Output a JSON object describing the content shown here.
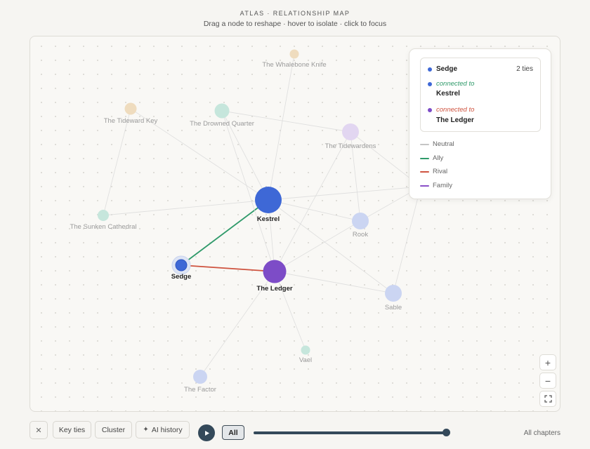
{
  "header": {
    "title": "ATLAS · RELATIONSHIP MAP",
    "subtitle": "Drag a node to reshape · hover to isolate · click to focus"
  },
  "graph": {
    "nodes": [
      {
        "id": "whalebone",
        "label": "The Whalebone Knife",
        "color": "#efdcbe",
        "r": 6.5,
        "state": "faded"
      },
      {
        "id": "tideward",
        "label": "The Tideward Key",
        "color": "#efdcbe",
        "r": 8.5,
        "state": "faded"
      },
      {
        "id": "drowned",
        "label": "The Drowned Quarter",
        "color": "#c6e6dc",
        "r": 10.5,
        "state": "faded"
      },
      {
        "id": "tidewardens",
        "label": "The Tidewardens",
        "color": "#e2d6f1",
        "r": 12,
        "state": "faded"
      },
      {
        "id": "sunken",
        "label": "The Sunken Cathedral",
        "color": "#c6e6dc",
        "r": 8,
        "state": "faded"
      },
      {
        "id": "kestrel",
        "label": "Kestrel",
        "color": "#3e68d6",
        "r": 19,
        "state": "active"
      },
      {
        "id": "rook",
        "label": "Rook",
        "color": "#cbd5f2",
        "r": 12,
        "state": "faded"
      },
      {
        "id": "sedge",
        "label": "Sedge",
        "color": "#3e68d6",
        "r": 8,
        "state": "focus"
      },
      {
        "id": "ledger",
        "label": "The Ledger",
        "color": "#7d4cc7",
        "r": 16.5,
        "state": "active"
      },
      {
        "id": "sable",
        "label": "Sable",
        "color": "#cbd5f2",
        "r": 12,
        "state": "faded"
      },
      {
        "id": "vael",
        "label": "Vael",
        "color": "#c6e6dc",
        "r": 6.5,
        "state": "faded"
      },
      {
        "id": "factor",
        "label": "The Factor",
        "color": "#cbd5f2",
        "r": 10,
        "state": "faded"
      },
      {
        "id": "edge_right",
        "label": "",
        "color": "#cbd5f2",
        "r": 0,
        "state": "hidden"
      }
    ],
    "edges": [
      {
        "source": "sedge",
        "target": "kestrel",
        "type": "ally",
        "highlight": true
      },
      {
        "source": "sedge",
        "target": "ledger",
        "type": "rival",
        "highlight": true
      },
      {
        "source": "kestrel",
        "target": "whalebone",
        "type": "neutral"
      },
      {
        "source": "kestrel",
        "target": "tideward",
        "type": "neutral"
      },
      {
        "source": "kestrel",
        "target": "drowned",
        "type": "neutral"
      },
      {
        "source": "kestrel",
        "target": "sunken",
        "type": "neutral"
      },
      {
        "source": "kestrel",
        "target": "rook",
        "type": "neutral"
      },
      {
        "source": "kestrel",
        "target": "sable",
        "type": "neutral"
      },
      {
        "source": "kestrel",
        "target": "ledger",
        "type": "neutral"
      },
      {
        "source": "kestrel",
        "target": "edge_right",
        "type": "neutral"
      },
      {
        "source": "ledger",
        "target": "tidewardens",
        "type": "neutral"
      },
      {
        "source": "ledger",
        "target": "drowned",
        "type": "neutral"
      },
      {
        "source": "ledger",
        "target": "rook",
        "type": "neutral"
      },
      {
        "source": "ledger",
        "target": "sable",
        "type": "neutral"
      },
      {
        "source": "ledger",
        "target": "vael",
        "type": "neutral"
      },
      {
        "source": "ledger",
        "target": "factor",
        "type": "neutral"
      },
      {
        "source": "tideward",
        "target": "sunken",
        "type": "neutral"
      },
      {
        "source": "drowned",
        "target": "tidewardens",
        "type": "neutral"
      },
      {
        "source": "tidewardens",
        "target": "rook",
        "type": "neutral"
      },
      {
        "source": "tidewardens",
        "target": "edge_right",
        "type": "neutral"
      },
      {
        "source": "rook",
        "target": "edge_right",
        "type": "neutral"
      },
      {
        "source": "sable",
        "target": "edge_right",
        "type": "neutral"
      }
    ]
  },
  "popup": {
    "focus": {
      "name": "Sedge",
      "ties": "2 ties",
      "color": "#3e68d6"
    },
    "connections": [
      {
        "label": "connected to",
        "target": "Kestrel",
        "label_color": "#2f9a6a",
        "dot_color": "#3e68d6"
      },
      {
        "label": "connected to",
        "target": "The Ledger",
        "label_color": "#cf5440",
        "dot_color": "#7d4cc7"
      }
    ],
    "legend": [
      {
        "label": "Neutral",
        "color": "#c5c5c5"
      },
      {
        "label": "Ally",
        "color": "#2f9a6a"
      },
      {
        "label": "Rival",
        "color": "#cf5440"
      },
      {
        "label": "Family",
        "color": "#8a50c8"
      }
    ]
  },
  "zoom": {
    "in": "+",
    "out": "−",
    "fit": "⛶"
  },
  "toolbar": {
    "close": "✕",
    "key_ties": "Key ties",
    "cluster": "Cluster",
    "ai_icon": "✦",
    "ai_history": "AI history",
    "all": "All",
    "timeline_progress": 1.0,
    "chapters": "All chapters"
  },
  "colors": {
    "ally": "#2f9a6a",
    "rival": "#cf5440",
    "neutral": "#dcdcdc",
    "accent": "#34495a"
  }
}
